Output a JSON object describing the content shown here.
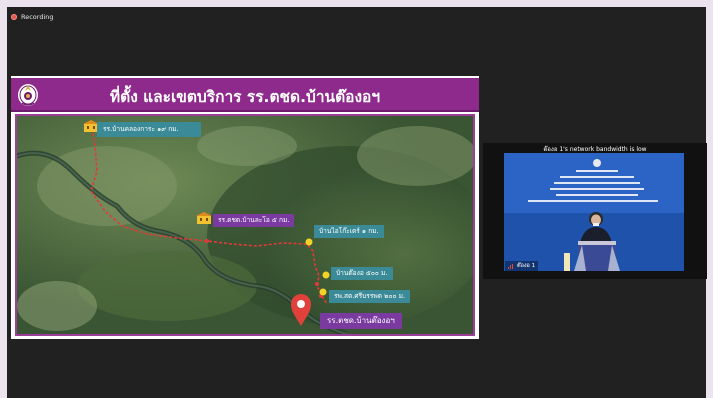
{
  "recording": {
    "label": "Recording"
  },
  "slide": {
    "title": "ที่ตั้ง และเขตบริการ  รร.ตชด.บ้านต๊องอฯ",
    "map": {
      "labels": {
        "school_top": "รร.บ้านคลองการะ ๑๙ กม.",
        "school_mid": "รร.ตชด.บ้านละโอ ๕ กม.",
        "village_1": "บ้านไอโก๊ะเตร์ ๑ กม.",
        "village_2": "บ้านต๊องอ ๕๐๐ ม.",
        "hospital": "รพ.สต.ศรีบรรพต ๒๐๐ ม.",
        "destination": "รร.ตชด.บ้านต๊องอฯ"
      }
    }
  },
  "participant": {
    "network_notice": "ต๊องอ 1's network bandwidth is low",
    "name": "ต๊องอ 1"
  },
  "colors": {
    "header_purple": "#8e2a8c",
    "label_teal": "#3b8a97",
    "label_purple": "#7a3aa0",
    "route_red": "#e23a3a",
    "pin_red": "#e0413a",
    "marker_yellow": "#f4d22a"
  }
}
